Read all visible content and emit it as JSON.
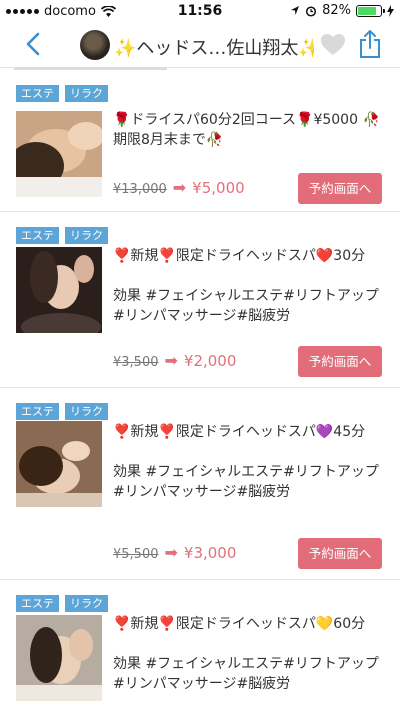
{
  "status_bar": {
    "carrier": "docomo",
    "time": "11:56",
    "battery": "82%",
    "battery_level": 0.82
  },
  "nav": {
    "title": "✨ヘッドス…佐山翔太✨"
  },
  "items": [
    {
      "tags": [
        "エステ",
        "リラク"
      ],
      "description": "🌹ドライスパ60分2回コース🌹¥5000 🥀期限8月末まで🥀",
      "body": "",
      "old_price": "¥13,000",
      "arrow": "➡",
      "new_price": "¥5,000",
      "button": "予約画面へ"
    },
    {
      "tags": [
        "エステ",
        "リラク"
      ],
      "description": "❣️新規❣️限定ドライヘッドスパ❤️30分",
      "body": "効果 #フェイシャルエステ#リフトアップ#リンパマッサージ#脳疲労",
      "old_price": "¥3,500",
      "arrow": "➡",
      "new_price": "¥2,000",
      "button": "予約画面へ"
    },
    {
      "tags": [
        "エステ",
        "リラク"
      ],
      "description": "❣️新規❣️限定ドライヘッドスパ💜45分",
      "body": "効果 #フェイシャルエステ#リフトアップ#リンパマッサージ#脳疲労",
      "old_price": "¥5,500",
      "arrow": "➡",
      "new_price": "¥3,000",
      "button": "予約画面へ"
    },
    {
      "tags": [
        "エステ",
        "リラク"
      ],
      "description": "❣️新規❣️限定ドライヘッドスパ💛60分",
      "body": "効果 #フェイシャルエステ#リフトアップ#リンパマッサージ#脳疲労",
      "old_price": "",
      "arrow": "",
      "new_price": "",
      "button": ""
    }
  ],
  "colors": {
    "accent": "#e26d79",
    "tag": "#5ba6d6",
    "nav_icon": "#3a8fd0"
  },
  "icons": {
    "back": "chevron-left-icon",
    "favorite": "heart-icon",
    "share": "share-icon"
  }
}
